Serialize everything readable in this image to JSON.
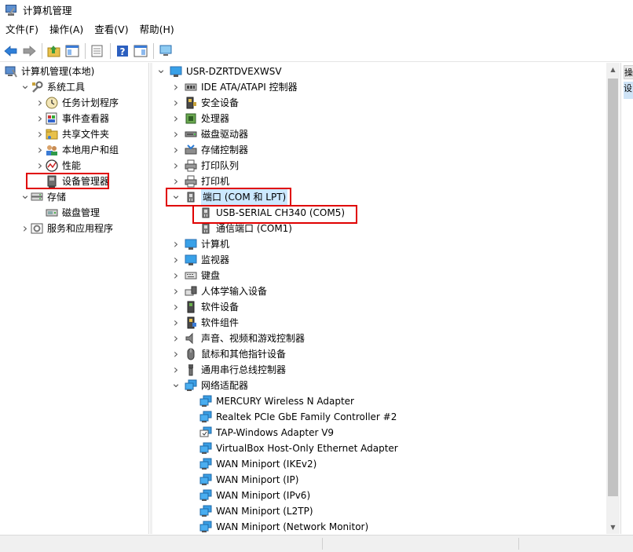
{
  "window": {
    "title": "计算机管理"
  },
  "menu": [
    "文件(F)",
    "操作(A)",
    "查看(V)",
    "帮助(H)"
  ],
  "left_tree": [
    {
      "label": "计算机管理(本地)",
      "indent": 0,
      "chev": "",
      "icon": "computer-management-icon"
    },
    {
      "label": "系统工具",
      "indent": 1,
      "chev": "down",
      "icon": "tools-icon"
    },
    {
      "label": "任务计划程序",
      "indent": 2,
      "chev": "right",
      "icon": "clock-icon"
    },
    {
      "label": "事件查看器",
      "indent": 2,
      "chev": "right",
      "icon": "event-viewer-icon"
    },
    {
      "label": "共享文件夹",
      "indent": 2,
      "chev": "right",
      "icon": "shared-folder-icon"
    },
    {
      "label": "本地用户和组",
      "indent": 2,
      "chev": "right",
      "icon": "users-icon"
    },
    {
      "label": "性能",
      "indent": 2,
      "chev": "right",
      "icon": "performance-icon"
    },
    {
      "label": "设备管理器",
      "indent": 2,
      "chev": "",
      "icon": "device-manager-icon",
      "highlight": true
    },
    {
      "label": "存储",
      "indent": 1,
      "chev": "down",
      "icon": "storage-icon"
    },
    {
      "label": "磁盘管理",
      "indent": 2,
      "chev": "",
      "icon": "disk-management-icon"
    },
    {
      "label": "服务和应用程序",
      "indent": 1,
      "chev": "right",
      "icon": "services-icon"
    }
  ],
  "device_tree": [
    {
      "label": "USR-DZRTDVEXWSV",
      "indent": 0,
      "chev": "down",
      "icon": "computer-icon"
    },
    {
      "label": "IDE ATA/ATAPI 控制器",
      "indent": 1,
      "chev": "right",
      "icon": "ide-controller-icon"
    },
    {
      "label": "安全设备",
      "indent": 1,
      "chev": "right",
      "icon": "security-device-icon"
    },
    {
      "label": "处理器",
      "indent": 1,
      "chev": "right",
      "icon": "processor-icon"
    },
    {
      "label": "磁盘驱动器",
      "indent": 1,
      "chev": "right",
      "icon": "disk-drive-icon"
    },
    {
      "label": "存储控制器",
      "indent": 1,
      "chev": "right",
      "icon": "storage-controller-icon"
    },
    {
      "label": "打印队列",
      "indent": 1,
      "chev": "right",
      "icon": "printer-icon"
    },
    {
      "label": "打印机",
      "indent": 1,
      "chev": "right",
      "icon": "printer-icon"
    },
    {
      "label": "端口 (COM 和 LPT)",
      "indent": 1,
      "chev": "down",
      "icon": "port-icon",
      "selected": true
    },
    {
      "label": "USB-SERIAL CH340 (COM5)",
      "indent": 2,
      "chev": "",
      "icon": "port-icon"
    },
    {
      "label": "通信端口 (COM1)",
      "indent": 2,
      "chev": "",
      "icon": "port-icon"
    },
    {
      "label": "计算机",
      "indent": 1,
      "chev": "right",
      "icon": "computer-icon"
    },
    {
      "label": "监视器",
      "indent": 1,
      "chev": "right",
      "icon": "monitor-icon"
    },
    {
      "label": "键盘",
      "indent": 1,
      "chev": "right",
      "icon": "keyboard-icon"
    },
    {
      "label": "人体学输入设备",
      "indent": 1,
      "chev": "right",
      "icon": "hid-icon"
    },
    {
      "label": "软件设备",
      "indent": 1,
      "chev": "right",
      "icon": "software-device-icon"
    },
    {
      "label": "软件组件",
      "indent": 1,
      "chev": "right",
      "icon": "software-component-icon"
    },
    {
      "label": "声音、视频和游戏控制器",
      "indent": 1,
      "chev": "right",
      "icon": "speaker-icon"
    },
    {
      "label": "鼠标和其他指针设备",
      "indent": 1,
      "chev": "right",
      "icon": "mouse-icon"
    },
    {
      "label": "通用串行总线控制器",
      "indent": 1,
      "chev": "right",
      "icon": "usb-icon"
    },
    {
      "label": "网络适配器",
      "indent": 1,
      "chev": "down",
      "icon": "network-icon"
    },
    {
      "label": "MERCURY Wireless N Adapter",
      "indent": 2,
      "chev": "",
      "icon": "network-icon"
    },
    {
      "label": "Realtek PCIe GbE Family Controller #2",
      "indent": 2,
      "chev": "",
      "icon": "network-icon"
    },
    {
      "label": "TAP-Windows Adapter V9",
      "indent": 2,
      "chev": "",
      "icon": "network-tap-icon"
    },
    {
      "label": "VirtualBox Host-Only Ethernet Adapter",
      "indent": 2,
      "chev": "",
      "icon": "network-icon"
    },
    {
      "label": "WAN Miniport (IKEv2)",
      "indent": 2,
      "chev": "",
      "icon": "network-icon"
    },
    {
      "label": "WAN Miniport (IP)",
      "indent": 2,
      "chev": "",
      "icon": "network-icon"
    },
    {
      "label": "WAN Miniport (IPv6)",
      "indent": 2,
      "chev": "",
      "icon": "network-icon"
    },
    {
      "label": "WAN Miniport (L2TP)",
      "indent": 2,
      "chev": "",
      "icon": "network-icon"
    },
    {
      "label": "WAN Miniport (Network Monitor)",
      "indent": 2,
      "chev": "",
      "icon": "network-icon"
    }
  ],
  "right_strip": {
    "head": "操",
    "item": "设"
  },
  "colors": {
    "highlight_red": "#e00000",
    "selection": "#cce8ff",
    "accent_blue": "#1e73c8"
  }
}
